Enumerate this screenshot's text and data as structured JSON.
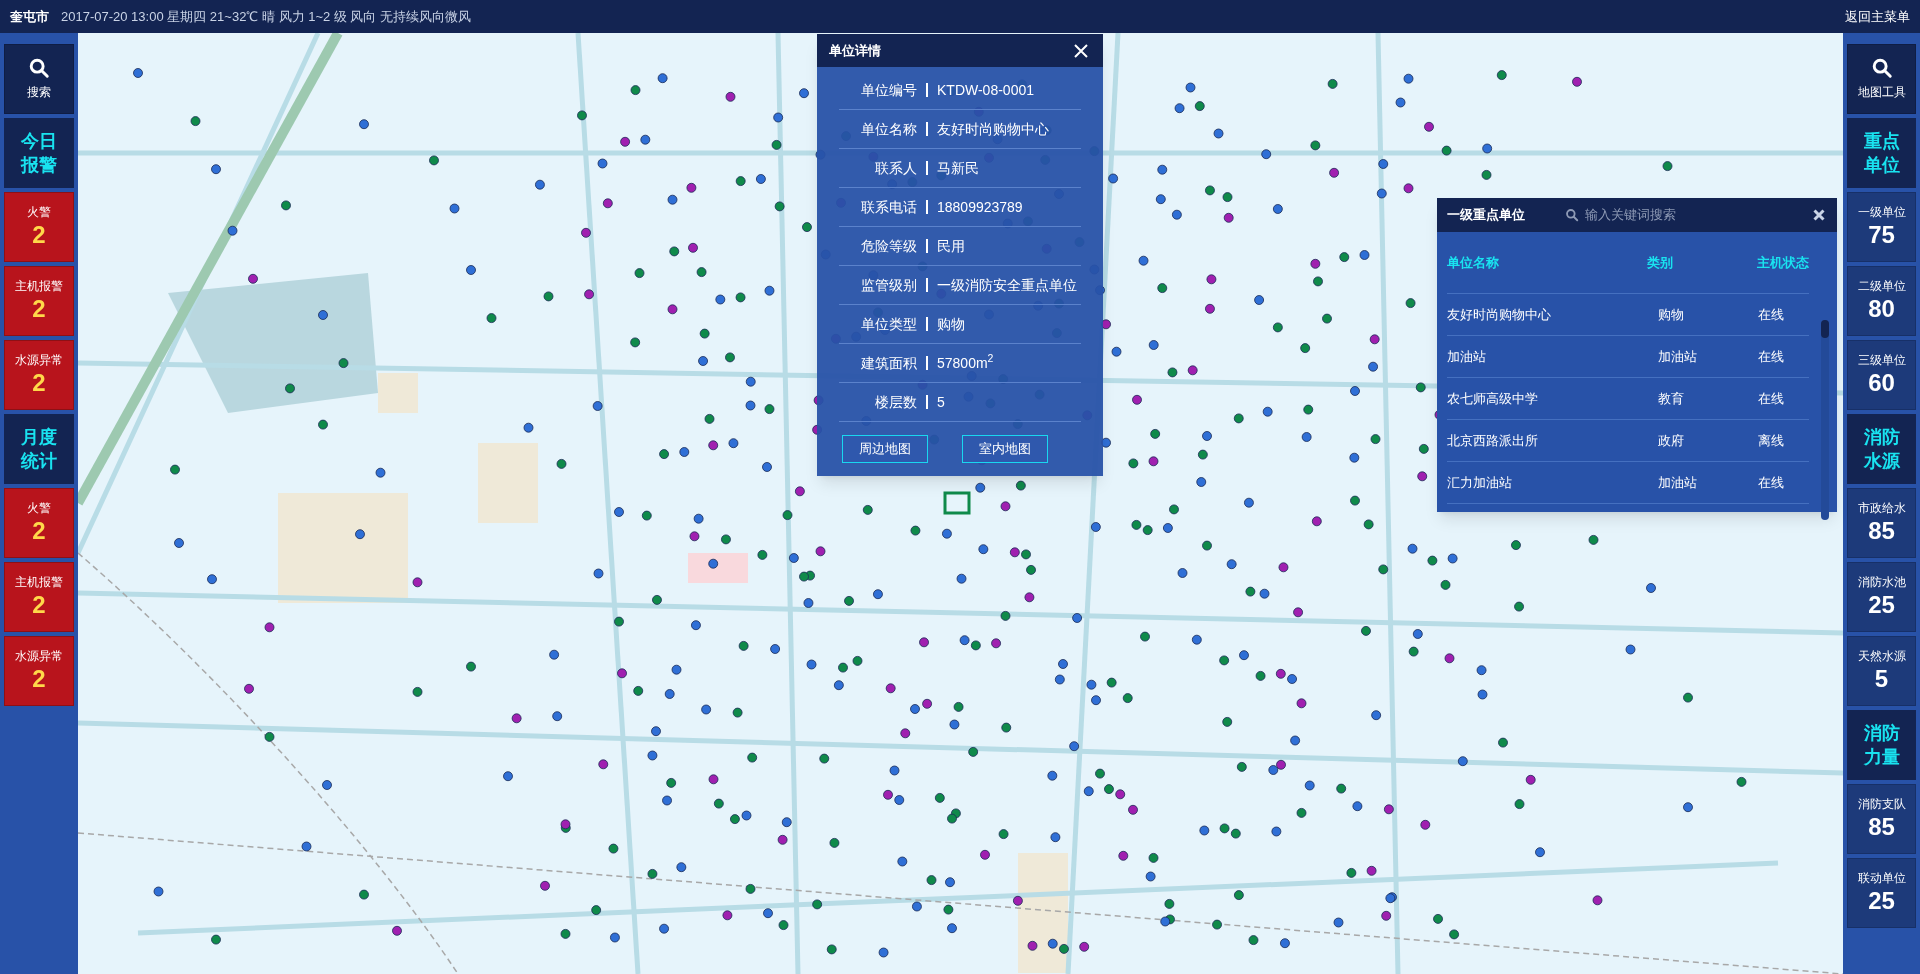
{
  "top_bar": {
    "city": "奎屯市",
    "weather": "2017-07-20 13:00 星期四 21~32℃ 晴 风力 1~2 级 风向 无持续风向微风",
    "back_link": "返回主菜单"
  },
  "left_sidebar": [
    {
      "kind": "search",
      "label": "搜索"
    },
    {
      "kind": "header",
      "label": "今日报警"
    },
    {
      "kind": "alert",
      "label": "火警",
      "value": "2"
    },
    {
      "kind": "alert",
      "label": "主机报警",
      "value": "2"
    },
    {
      "kind": "alert",
      "label": "水源异常",
      "value": "2"
    },
    {
      "kind": "header",
      "label": "月度统计"
    },
    {
      "kind": "alert",
      "label": "火警",
      "value": "2"
    },
    {
      "kind": "alert",
      "label": "主机报警",
      "value": "2"
    },
    {
      "kind": "alert",
      "label": "水源异常",
      "value": "2"
    }
  ],
  "right_sidebar": [
    {
      "kind": "search",
      "label": "地图工具"
    },
    {
      "kind": "header",
      "label": "重点单位"
    },
    {
      "kind": "stat",
      "label": "一级单位",
      "value": "75"
    },
    {
      "kind": "stat",
      "label": "二级单位",
      "value": "80"
    },
    {
      "kind": "stat",
      "label": "三级单位",
      "value": "60"
    },
    {
      "kind": "header",
      "label": "消防水源"
    },
    {
      "kind": "stat",
      "label": "市政给水",
      "value": "85"
    },
    {
      "kind": "stat",
      "label": "消防水池",
      "value": "25"
    },
    {
      "kind": "stat",
      "label": "天然水源",
      "value": "5"
    },
    {
      "kind": "header",
      "label": "消防力量"
    },
    {
      "kind": "stat",
      "label": "消防支队",
      "value": "85"
    },
    {
      "kind": "stat",
      "label": "联动单位",
      "value": "25"
    }
  ],
  "detail_popup": {
    "title": "单位详情",
    "fields": [
      {
        "label": "单位编号",
        "value": "KTDW-08-0001"
      },
      {
        "label": "单位名称",
        "value": "友好时尚购物中心"
      },
      {
        "label": "联系人",
        "value": "马新民"
      },
      {
        "label": "联系电话",
        "value": "18809923789"
      },
      {
        "label": "危险等级",
        "value": "民用"
      },
      {
        "label": "监管级别",
        "value": "一级消防安全重点单位"
      },
      {
        "label": "单位类型",
        "value": "购物"
      },
      {
        "label": "建筑面积",
        "value": "57800m$^{2}$"
      },
      {
        "label": "楼层数",
        "value": "5"
      }
    ],
    "buttons": [
      "周边地图",
      "室内地图"
    ]
  },
  "units_panel": {
    "title": "一级重点单位",
    "search": {
      "placeholder": "输入关键词搜索"
    },
    "columns": [
      "单位名称",
      "类别",
      "主机状态"
    ],
    "rows": [
      [
        "友好时尚购物中心",
        "购物",
        "在线"
      ],
      [
        "加油站",
        "加油站",
        "在线"
      ],
      [
        "农七师高级中学",
        "教育",
        "在线"
      ],
      [
        "北京西路派出所",
        "政府",
        "离线"
      ],
      [
        "汇力加油站",
        "加油站",
        "在线"
      ]
    ]
  }
}
